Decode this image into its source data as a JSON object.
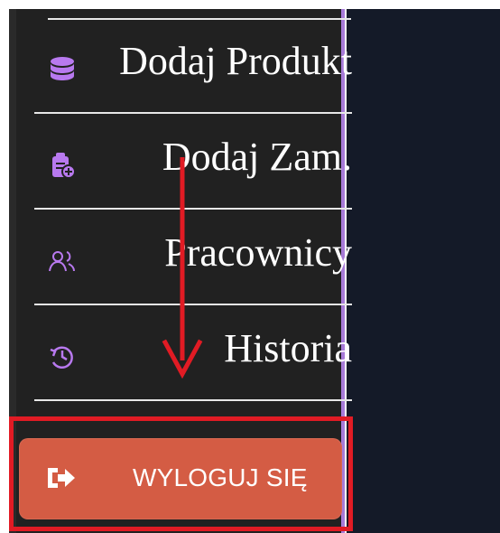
{
  "sidebar": {
    "items": [
      {
        "label": "Dodaj Produkt",
        "icon": "database-icon"
      },
      {
        "label": "Dodaj Zam.",
        "icon": "clipboard-add-icon"
      },
      {
        "label": "Pracownicy",
        "icon": "users-icon"
      },
      {
        "label": "Historia",
        "icon": "history-icon"
      }
    ],
    "logout": {
      "label": "WYLOGUJ SIĘ",
      "icon": "logout-arrow-icon"
    }
  },
  "colors": {
    "sidebar_background": "#212121",
    "sidebar_accent": "#b879ef",
    "page_background": "#141a28",
    "logout_button": "#d45c44",
    "annotation_red": "#e11b24"
  }
}
